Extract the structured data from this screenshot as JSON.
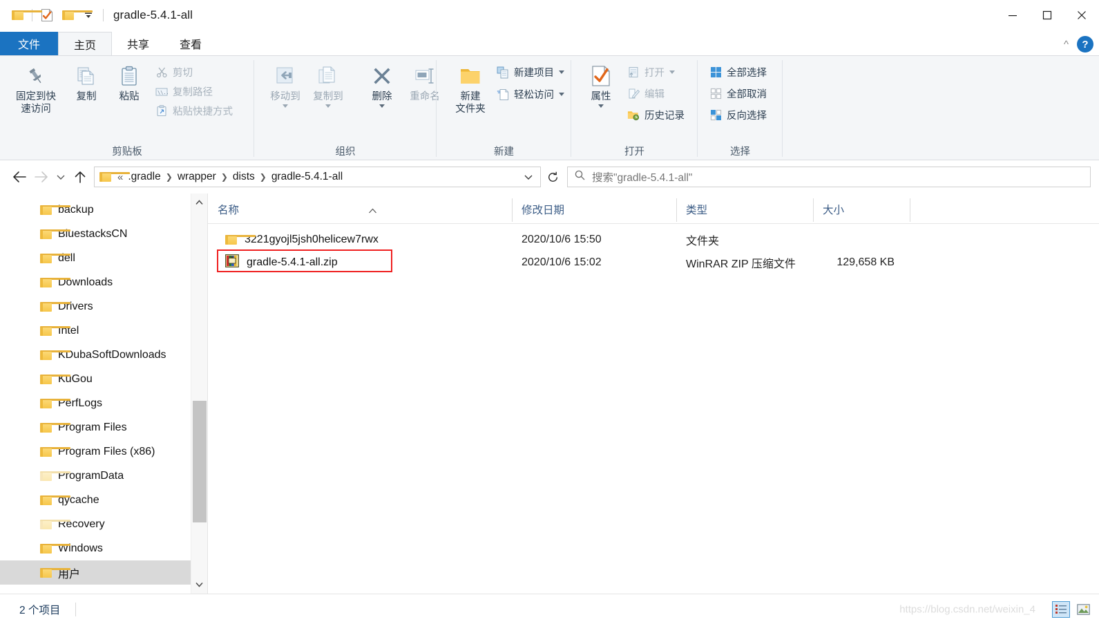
{
  "window": {
    "title": "gradle-5.4.1-all",
    "quick_access_icons": [
      "folder-icon",
      "properties-icon",
      "new-folder-icon",
      "qat-dropdown-icon"
    ],
    "controls": {
      "minimize": "—",
      "maximize": "☐",
      "close": "✕"
    }
  },
  "tabs": [
    {
      "id": "file",
      "label": "文件"
    },
    {
      "id": "home",
      "label": "主页"
    },
    {
      "id": "share",
      "label": "共享"
    },
    {
      "id": "view",
      "label": "查看"
    }
  ],
  "tab_right": {
    "collapse_icon": "chevron-up-icon",
    "help_label": "?"
  },
  "ribbon": {
    "groups": [
      {
        "id": "clipboard",
        "label": "剪贴板",
        "big_buttons": [
          {
            "id": "pin-to-quick-access",
            "label": "固定到快\n速访问",
            "line1": "固定到快",
            "line2": "速访问",
            "icon": "pin-icon"
          },
          {
            "id": "copy",
            "label": "复制",
            "icon": "copy-icon"
          },
          {
            "id": "paste",
            "label": "粘贴",
            "icon": "paste-icon"
          }
        ],
        "small_buttons": [
          {
            "id": "cut",
            "label": "剪切",
            "icon": "scissors-icon",
            "disabled": true
          },
          {
            "id": "copy-path",
            "label": "复制路径",
            "icon": "copy-path-icon",
            "disabled": true
          },
          {
            "id": "paste-shortcut",
            "label": "粘贴快捷方式",
            "icon": "paste-shortcut-icon",
            "disabled": true
          }
        ]
      },
      {
        "id": "organize",
        "label": "组织",
        "big_buttons": [
          {
            "id": "move-to",
            "label": "移动到",
            "icon": "move-to-icon",
            "has_caret": true,
            "disabled": true
          },
          {
            "id": "copy-to",
            "label": "复制到",
            "icon": "copy-to-icon",
            "has_caret": true,
            "disabled": true
          },
          {
            "id": "delete",
            "label": "删除",
            "icon": "delete-x-icon",
            "has_caret": true
          },
          {
            "id": "rename",
            "label": "重命名",
            "icon": "rename-icon",
            "disabled": true
          }
        ]
      },
      {
        "id": "new",
        "label": "新建",
        "big_buttons": [
          {
            "id": "new-folder",
            "label": "新建\n文件夹",
            "line1": "新建",
            "line2": "文件夹",
            "icon": "new-folder-icon"
          }
        ],
        "small_buttons": [
          {
            "id": "new-item",
            "label": "新建项目",
            "icon": "new-item-icon",
            "has_caret": true
          },
          {
            "id": "easy-access",
            "label": "轻松访问",
            "icon": "easy-access-icon",
            "has_caret": true
          }
        ]
      },
      {
        "id": "open",
        "label": "打开",
        "big_buttons": [
          {
            "id": "properties",
            "label": "属性",
            "icon": "properties-check-icon",
            "has_caret": true
          }
        ],
        "small_buttons": [
          {
            "id": "open",
            "label": "打开",
            "icon": "open-icon",
            "has_caret": true,
            "disabled": true
          },
          {
            "id": "edit",
            "label": "编辑",
            "icon": "edit-icon",
            "disabled": true
          },
          {
            "id": "history",
            "label": "历史记录",
            "icon": "history-icon"
          }
        ]
      },
      {
        "id": "select",
        "label": "选择",
        "small_buttons": [
          {
            "id": "select-all",
            "label": "全部选择",
            "icon": "select-all-icon"
          },
          {
            "id": "select-none",
            "label": "全部取消",
            "icon": "select-none-icon"
          },
          {
            "id": "invert-selection",
            "label": "反向选择",
            "icon": "invert-selection-icon"
          }
        ]
      }
    ]
  },
  "addressbar": {
    "back_icon": "arrow-left-icon",
    "forward_icon": "arrow-right-icon",
    "recent_icon": "chevron-down-icon",
    "up_icon": "arrow-up-icon",
    "path_leading": "«",
    "breadcrumbs": [
      ".gradle",
      "wrapper",
      "dists",
      "gradle-5.4.1-all"
    ],
    "dropdown_icon": "chevron-down-icon",
    "refresh_icon": "refresh-icon",
    "search_icon": "search-icon",
    "search_placeholder": "搜索\"gradle-5.4.1-all\""
  },
  "navpane": {
    "items": [
      {
        "label": "backup",
        "pale": false,
        "selected": false
      },
      {
        "label": "BluestacksCN",
        "pale": false,
        "selected": false
      },
      {
        "label": "dell",
        "pale": false,
        "selected": false
      },
      {
        "label": "Downloads",
        "pale": false,
        "selected": false
      },
      {
        "label": "Drivers",
        "pale": false,
        "selected": false
      },
      {
        "label": "Intel",
        "pale": false,
        "selected": false
      },
      {
        "label": "KDubaSoftDownloads",
        "pale": false,
        "selected": false
      },
      {
        "label": "KuGou",
        "pale": false,
        "selected": false
      },
      {
        "label": "PerfLogs",
        "pale": false,
        "selected": false
      },
      {
        "label": "Program Files",
        "pale": false,
        "selected": false
      },
      {
        "label": "Program Files (x86)",
        "pale": false,
        "selected": false
      },
      {
        "label": "ProgramData",
        "pale": true,
        "selected": false
      },
      {
        "label": "qycache",
        "pale": false,
        "selected": false
      },
      {
        "label": "Recovery",
        "pale": true,
        "selected": false
      },
      {
        "label": "Windows",
        "pale": false,
        "selected": false
      },
      {
        "label": "用户",
        "pale": false,
        "selected": true
      }
    ],
    "scroll_up_icon": "chevron-up-icon",
    "scroll_down_icon": "chevron-down-icon"
  },
  "filelist": {
    "columns": [
      {
        "id": "name",
        "label": "名称",
        "sorted": true,
        "sort_icon": "sort-asc-icon"
      },
      {
        "id": "date",
        "label": "修改日期"
      },
      {
        "id": "type",
        "label": "类型"
      },
      {
        "id": "size",
        "label": "大小"
      }
    ],
    "rows": [
      {
        "name": "3221gyojl5jsh0helicew7rwx",
        "date": "2020/10/6 15:50",
        "type": "文件夹",
        "size": "",
        "icon": "folder-icon",
        "highlighted": false
      },
      {
        "name": "gradle-5.4.1-all.zip",
        "date": "2020/10/6 15:02",
        "type": "WinRAR ZIP 压缩文件",
        "size": "129,658 KB",
        "icon": "winrar-zip-icon",
        "highlighted": true
      }
    ]
  },
  "statusbar": {
    "item_count": "2 个项目",
    "watermark": "https://blog.csdn.net/weixin_4",
    "view_details_icon": "details-view-icon",
    "view_large_icon": "large-icons-view-icon"
  },
  "colors": {
    "accent": "#1b73c1",
    "ribbon_bg": "#f4f6f8",
    "highlight_red": "#ef2020",
    "selection_gray": "#d9d9d9",
    "header_text": "#3b5c86"
  }
}
